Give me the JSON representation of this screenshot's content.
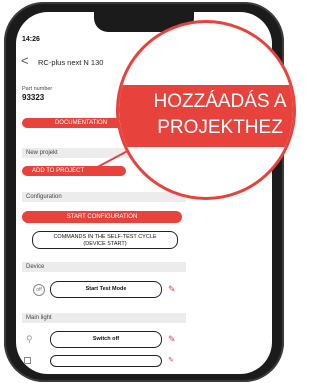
{
  "app": {
    "time": "14:26",
    "back_glyph": "<",
    "title": "RC-plus next N 130"
  },
  "part": {
    "label": "Part number",
    "value": "93323"
  },
  "buttons": {
    "documentation": "DOCUMENTATION",
    "add_to_project": "ADD TO PROJECT",
    "start_configuration": "START CONFIGURATION",
    "commands_line1": "COMMANDS IN THE SELF-TEST CYCLE",
    "commands_line2": "(DEVICE START)",
    "start_test_mode": "Start Test Mode",
    "switch_off": "Switch off"
  },
  "sections": {
    "new_project": "New projekt",
    "configuration": "Configuration",
    "device": "Device",
    "main_light": "Main light"
  },
  "device_icon_text": "off",
  "magnifier": {
    "line1": "HOZZÁADÁS A",
    "line2": "PROJEKTHEZ"
  },
  "colors": {
    "accent": "#e8423c",
    "phone_frame": "#1b1b1b",
    "section_bg": "#ececec"
  },
  "icons": [
    "pencil-icon",
    "power-icon",
    "bulb-icon",
    "back-chevron-icon"
  ]
}
